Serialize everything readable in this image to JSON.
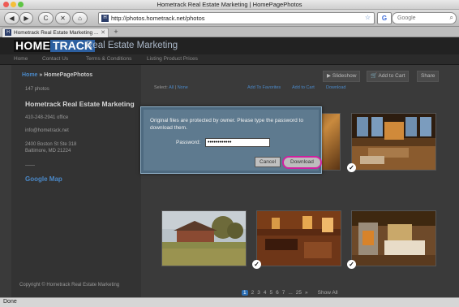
{
  "window": {
    "title": "Hometrack Real Estate Marketing | HomePagePhotos"
  },
  "toolbar": {
    "back": "◀",
    "forward": "▶",
    "reload": "C",
    "stop": "✕",
    "home": "⌂",
    "url": "http://photos.hometrack.net/photos",
    "search_placeholder": "Google"
  },
  "tab": {
    "label": "Hometrack Real Estate Marketing ...",
    "new": "+"
  },
  "site": {
    "logo_home": "HOME",
    "logo_track": "TRACK",
    "logo_text": "Real Estate Marketing",
    "nav": [
      "Home",
      "Contact Us",
      "Terms & Conditions",
      "Listing Product Prices"
    ]
  },
  "sidebar": {
    "breadcrumb_home": "Home",
    "breadcrumb_current": " » HomePagePhotos",
    "photo_count": "147 photos",
    "company": "Hometrack Real Estate Marketing",
    "phone": "410-248-2941 office",
    "email": "info@hometrack.net",
    "address_line1": "2400 Boston St Ste 318",
    "address_line2": "Baltimore, MD 21224",
    "separator": "——",
    "map_link": "Google Map",
    "copyright": "Copyright © Hometrack Real Estate Marketing"
  },
  "actions": {
    "slideshow": "▶ Slideshow",
    "add_to_cart": "Add to Cart",
    "share": "Share"
  },
  "select_row": {
    "select_label": "Select:",
    "all": "All",
    "divider": "|",
    "none": "None",
    "add_favorites": "Add To Favorites",
    "add_cart": "Add to Cart",
    "download": "Download"
  },
  "modal": {
    "message": "Original files are protected by owner. Please type the password to download them.",
    "password_label": "Password:",
    "password_value": "••••••••••••",
    "cancel": "Cancel",
    "download": "Download"
  },
  "pagination": {
    "pages": [
      "1",
      "2",
      "3",
      "4",
      "5",
      "6",
      "7",
      "...",
      "25",
      "»"
    ],
    "current": "1",
    "show_all": "Show All"
  },
  "status": {
    "text": "Done"
  },
  "colors": {
    "accent_blue": "#4a88c7",
    "download_highlight": "#d021a0",
    "logo_track_bg": "#2c5fa0"
  }
}
